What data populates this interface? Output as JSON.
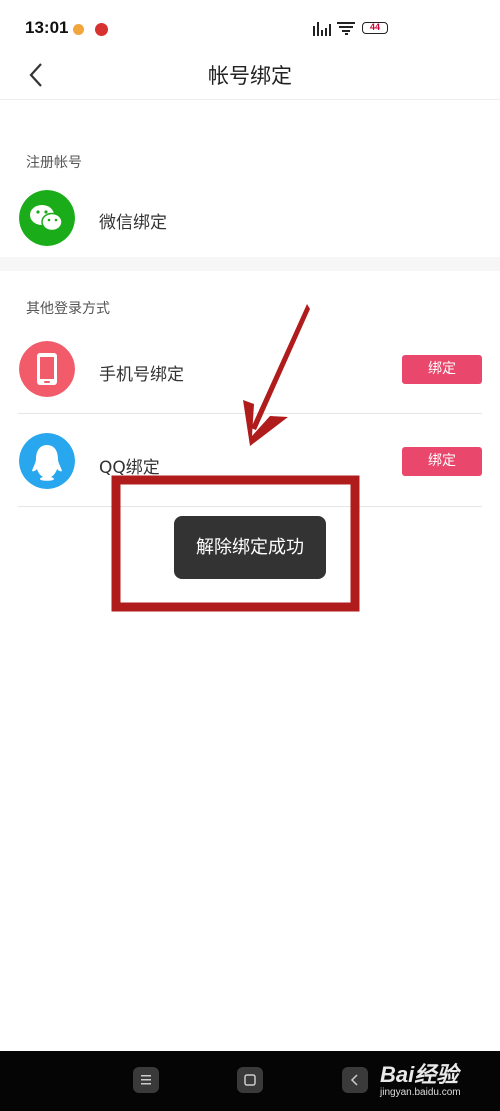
{
  "status_bar": {
    "time": "13:01",
    "battery": "44"
  },
  "nav": {
    "title": "帐号绑定"
  },
  "register_section": {
    "label": "注册帐号",
    "items": [
      {
        "label": "微信绑定",
        "icon": "wechat-icon",
        "color": "#1aad19"
      }
    ]
  },
  "other_section": {
    "label": "其他登录方式",
    "items": [
      {
        "label": "手机号绑定",
        "icon": "phone-icon",
        "color": "#f25c6a",
        "button": "绑定"
      },
      {
        "label": "QQ绑定",
        "icon": "qq-icon",
        "color": "#28a7ef",
        "button": "绑定"
      }
    ]
  },
  "toast": {
    "text": "解除绑定成功"
  },
  "watermark": {
    "logo": "Bai经验",
    "sub": "jingyan.baidu.com"
  },
  "colors": {
    "accent": "#e9476b",
    "annotation": "#b01c1c"
  }
}
